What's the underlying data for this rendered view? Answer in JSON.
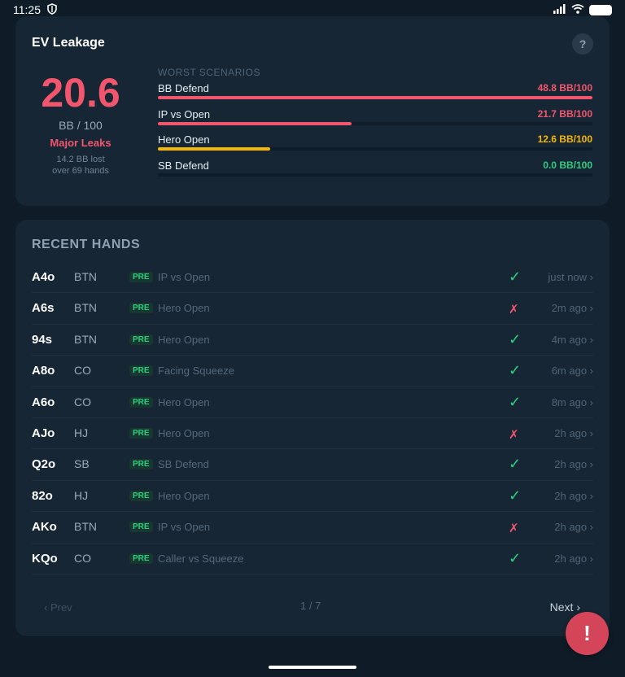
{
  "status_bar": {
    "time": "11:25"
  },
  "ev_card": {
    "title": "EV Leakage",
    "help_label": "?",
    "value": "20.6",
    "unit": "BB / 100",
    "status": "Major Leaks",
    "lost_line1": "14.2 BB lost",
    "lost_line2": "over 69 hands",
    "scenarios_heading": "WORST SCENARIOS",
    "scenarios": [
      {
        "name": "BB Defend",
        "value": "48.8 BB/100",
        "fill_fraction": 1.0,
        "color": "#f2566c"
      },
      {
        "name": "IP vs Open",
        "value": "21.7 BB/100",
        "fill_fraction": 0.445,
        "color": "#f2566c"
      },
      {
        "name": "Hero Open",
        "value": "12.6 BB/100",
        "fill_fraction": 0.258,
        "color": "#f5b800"
      },
      {
        "name": "SB Defend",
        "value": "0.0 BB/100",
        "fill_fraction": 0.0,
        "color": "#2dce7f"
      }
    ]
  },
  "recent_hands": {
    "title": "RECENT HANDS",
    "rows": [
      {
        "cards": "A4o",
        "position": "BTN",
        "street": "PRE",
        "scenario": "IP vs Open",
        "result": "✓",
        "result_type": "ok",
        "time": "just now ›"
      },
      {
        "cards": "A6s",
        "position": "BTN",
        "street": "PRE",
        "scenario": "Hero Open",
        "result": "✗",
        "result_type": "bad",
        "time": "2m ago ›"
      },
      {
        "cards": "94s",
        "position": "BTN",
        "street": "PRE",
        "scenario": "Hero Open",
        "result": "✓",
        "result_type": "ok",
        "time": "4m ago ›"
      },
      {
        "cards": "A8o",
        "position": "CO",
        "street": "PRE",
        "scenario": "Facing Squeeze",
        "result": "✓",
        "result_type": "ok",
        "time": "6m ago ›"
      },
      {
        "cards": "A6o",
        "position": "CO",
        "street": "PRE",
        "scenario": "Hero Open",
        "result": "✓",
        "result_type": "ok",
        "time": "8m ago ›"
      },
      {
        "cards": "AJo",
        "position": "HJ",
        "street": "PRE",
        "scenario": "Hero Open",
        "result": "✗",
        "result_type": "bad",
        "time": "2h ago ›"
      },
      {
        "cards": "Q2o",
        "position": "SB",
        "street": "PRE",
        "scenario": "SB Defend",
        "result": "✓",
        "result_type": "ok",
        "time": "2h ago ›"
      },
      {
        "cards": "82o",
        "position": "HJ",
        "street": "PRE",
        "scenario": "Hero Open",
        "result": "✓",
        "result_type": "ok",
        "time": "2h ago ›"
      },
      {
        "cards": "AKo",
        "position": "BTN",
        "street": "PRE",
        "scenario": "IP vs Open",
        "result": "✗",
        "result_type": "bad",
        "time": "2h ago ›"
      },
      {
        "cards": "KQo",
        "position": "CO",
        "street": "PRE",
        "scenario": "Caller vs Squeeze",
        "result": "✓",
        "result_type": "ok",
        "time": "2h ago ›"
      }
    ],
    "pager": {
      "prev": "‹ Prev",
      "page": "1 / 7",
      "next": "Next ›"
    }
  },
  "fab": {
    "label": "!"
  }
}
